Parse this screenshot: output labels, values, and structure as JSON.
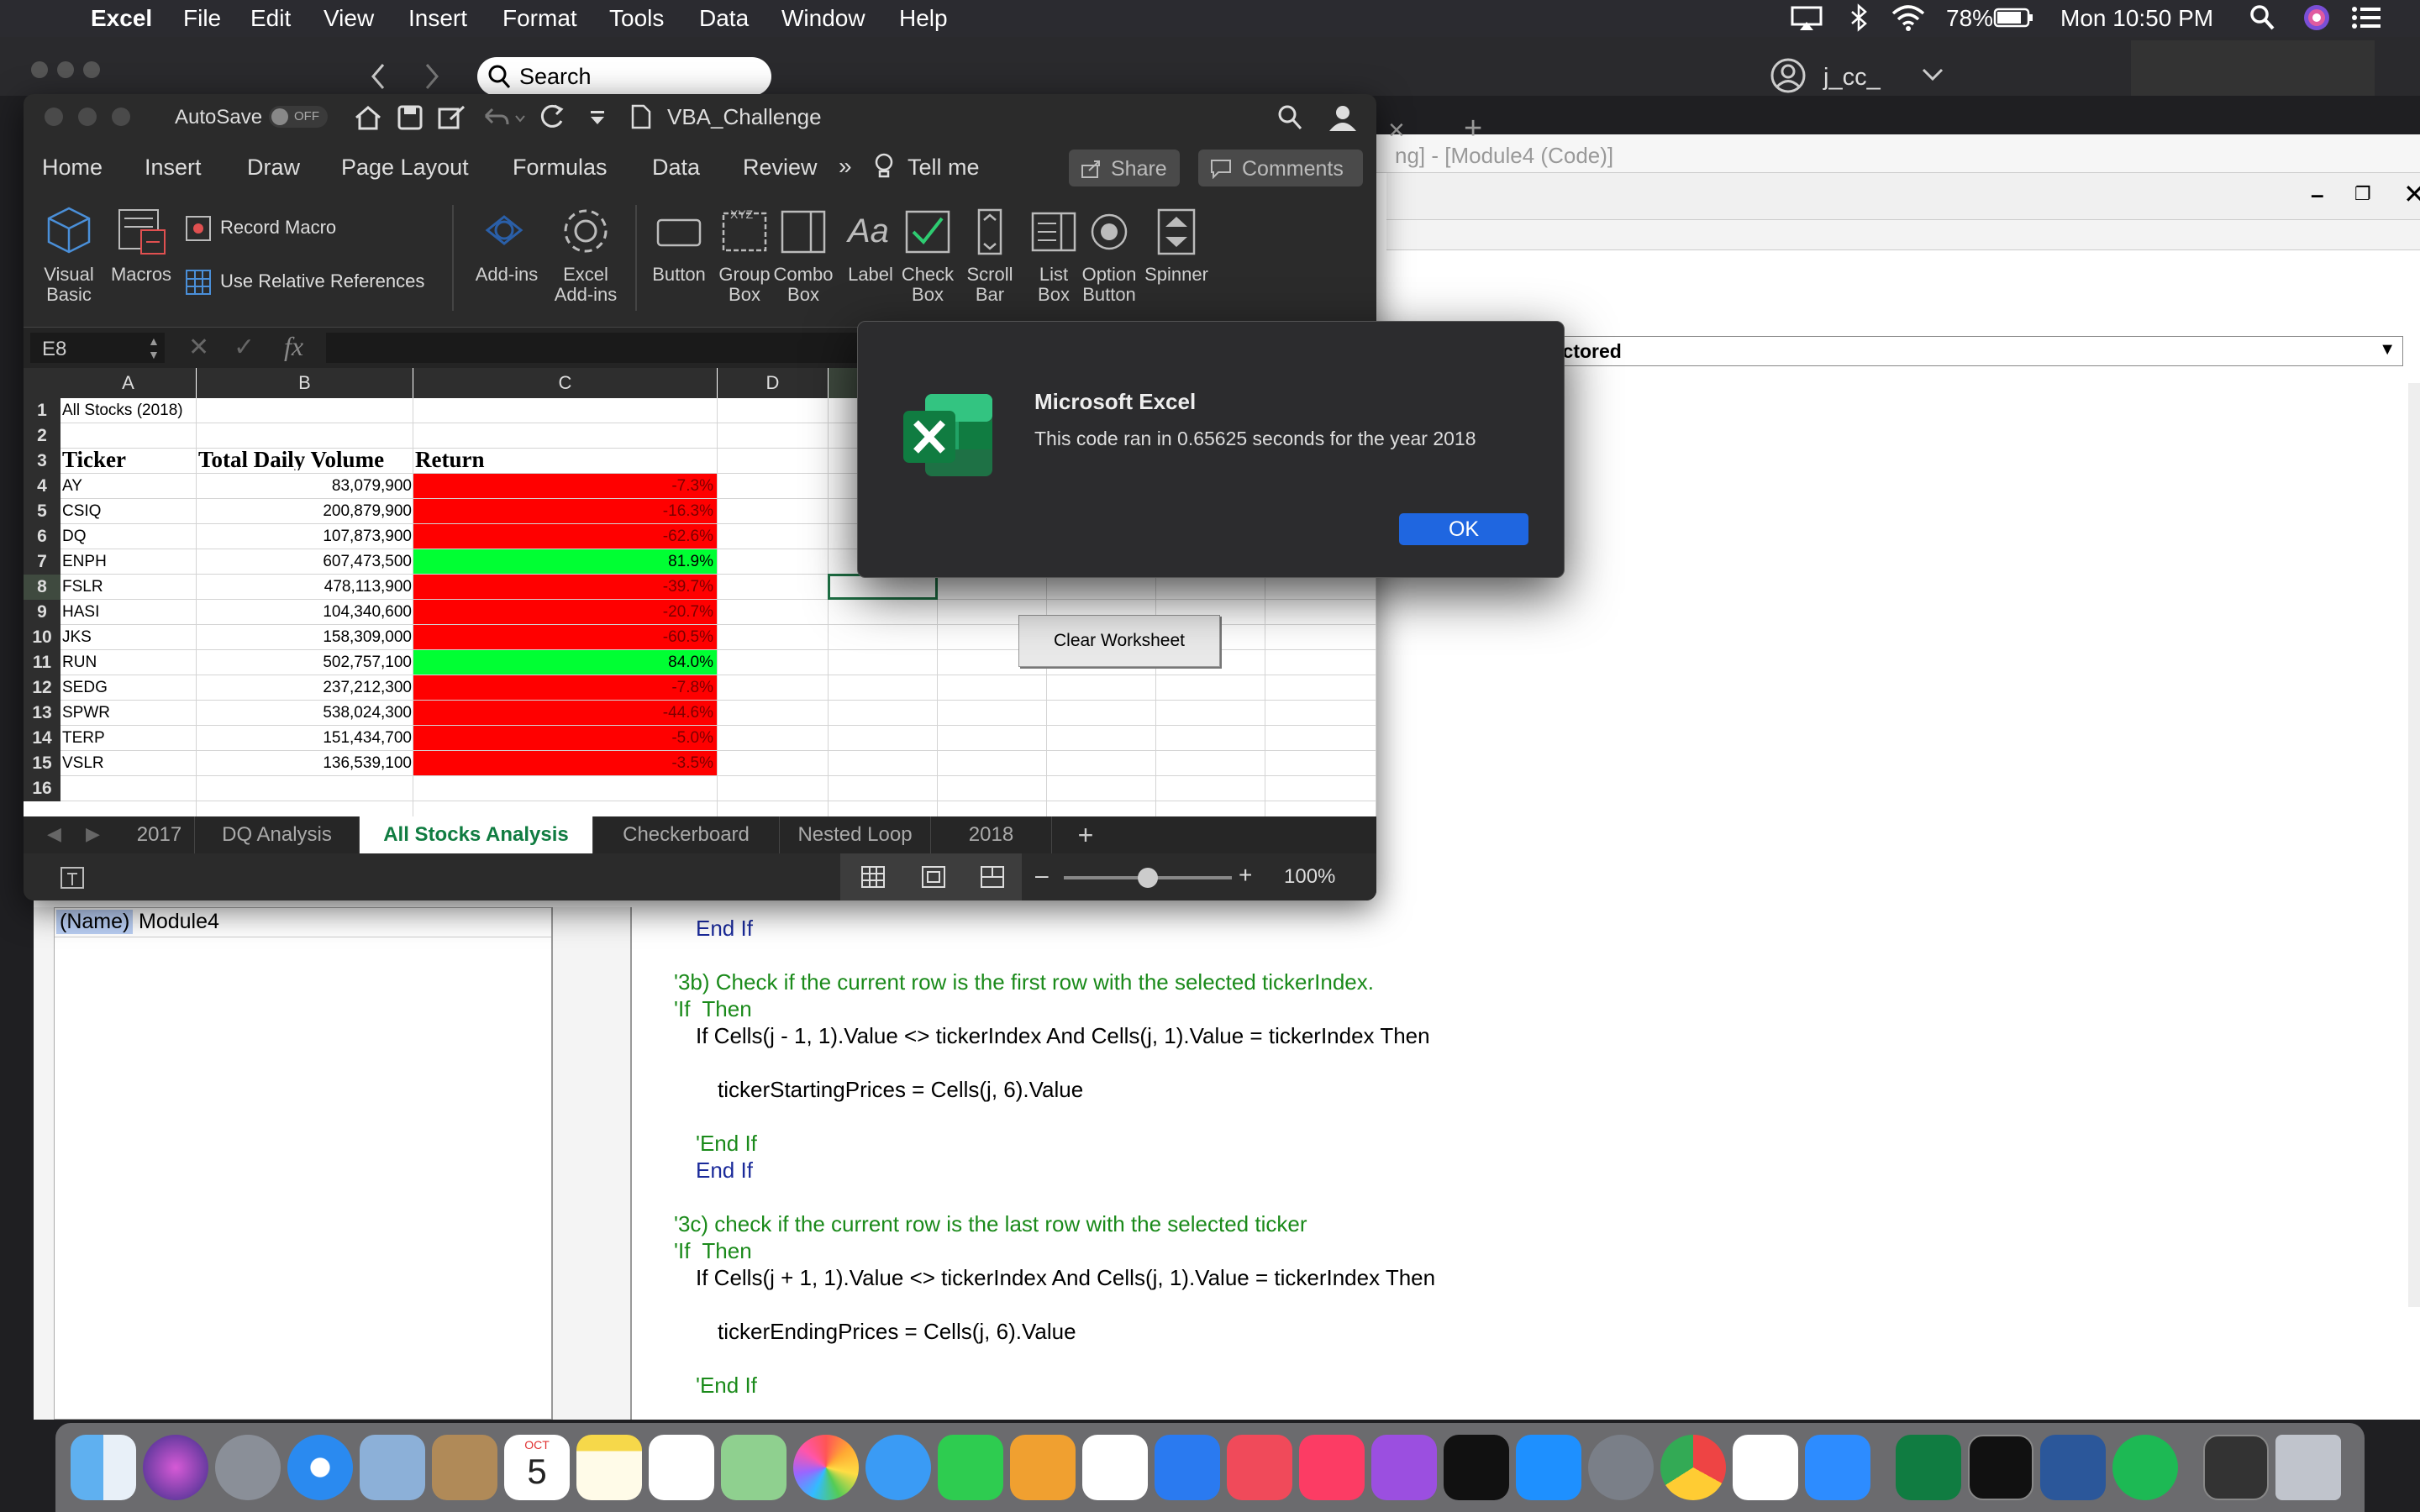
{
  "menubar": {
    "app": "Excel",
    "items": [
      "File",
      "Edit",
      "View",
      "Insert",
      "Format",
      "Tools",
      "Data",
      "Window",
      "Help"
    ],
    "battery": "78%",
    "clock": "Mon 10:50 PM"
  },
  "browser": {
    "search_label": "Search",
    "user": "j_cc_"
  },
  "vbe": {
    "title": "ng] - [Module4 (Code)]",
    "procedure": "tocksAnalysisRefactored",
    "props_name_label": "(Name)",
    "props_name_value": "Module4",
    "code": [
      {
        "t": "End If",
        "c": "kw",
        "indent": 1
      },
      {
        "t": "",
        "c": "",
        "indent": 0
      },
      {
        "t": "'3b) Check if the current row is the first row with the selected tickerIndex.",
        "c": "cm",
        "indent": 0
      },
      {
        "t": "'If  Then",
        "c": "cm",
        "indent": 0
      },
      {
        "t": "If Cells(j - 1, 1).Value <> tickerIndex And Cells(j, 1).Value = tickerIndex Then",
        "c": "mix",
        "indent": 1
      },
      {
        "t": "",
        "c": "",
        "indent": 0
      },
      {
        "t": "tickerStartingPrices = Cells(j, 6).Value",
        "c": "",
        "indent": 2
      },
      {
        "t": "",
        "c": "",
        "indent": 0
      },
      {
        "t": "'End If",
        "c": "cm",
        "indent": 1
      },
      {
        "t": "End If",
        "c": "kw",
        "indent": 1
      },
      {
        "t": "",
        "c": "",
        "indent": 0
      },
      {
        "t": "'3c) check if the current row is the last row with the selected ticker",
        "c": "cm",
        "indent": 0
      },
      {
        "t": "'If  Then",
        "c": "cm",
        "indent": 0
      },
      {
        "t": "If Cells(j + 1, 1).Value <> tickerIndex And Cells(j, 1).Value = tickerIndex Then",
        "c": "mix",
        "indent": 1
      },
      {
        "t": "",
        "c": "",
        "indent": 0
      },
      {
        "t": "tickerEndingPrices = Cells(j, 6).Value",
        "c": "",
        "indent": 2
      },
      {
        "t": "",
        "c": "",
        "indent": 0
      },
      {
        "t": "'End If",
        "c": "cm",
        "indent": 1
      }
    ]
  },
  "excel": {
    "autosave": "AutoSave",
    "autosave_state": "OFF",
    "doc_title": "VBA_Challenge",
    "tabs": [
      "Home",
      "Insert",
      "Draw",
      "Page Layout",
      "Formulas",
      "Data",
      "Review"
    ],
    "tell_me": "Tell me",
    "share": "Share",
    "comments": "Comments",
    "ribbon": {
      "visual_basic": [
        "Visual",
        "Basic"
      ],
      "macros": "Macros",
      "record_macro": "Record Macro",
      "relative_refs": "Use Relative References",
      "addins": "Add-ins",
      "excel_addins": [
        "Excel",
        "Add-ins"
      ],
      "controls": [
        [
          "Button",
          ""
        ],
        [
          "Group",
          "Box"
        ],
        [
          "Combo",
          "Box"
        ],
        [
          "Label",
          ""
        ],
        [
          "Check",
          "Box"
        ],
        [
          "Scroll",
          "Bar"
        ],
        [
          "List",
          "Box"
        ],
        [
          "Option",
          "Button"
        ],
        [
          "Spinner",
          ""
        ]
      ]
    },
    "name_box": "E8",
    "columns": [
      "A",
      "B",
      "C",
      "D"
    ],
    "sheet": {
      "title": "All Stocks (2018)",
      "headers": [
        "Ticker",
        "Total Daily Volume",
        "Return"
      ],
      "rows": [
        {
          "ticker": "AY",
          "volume": "83,079,900",
          "ret": "-7.3%",
          "pos": false
        },
        {
          "ticker": "CSIQ",
          "volume": "200,879,900",
          "ret": "-16.3%",
          "pos": false
        },
        {
          "ticker": "DQ",
          "volume": "107,873,900",
          "ret": "-62.6%",
          "pos": false
        },
        {
          "ticker": "ENPH",
          "volume": "607,473,500",
          "ret": "81.9%",
          "pos": true
        },
        {
          "ticker": "FSLR",
          "volume": "478,113,900",
          "ret": "-39.7%",
          "pos": false
        },
        {
          "ticker": "HASI",
          "volume": "104,340,600",
          "ret": "-20.7%",
          "pos": false
        },
        {
          "ticker": "JKS",
          "volume": "158,309,000",
          "ret": "-60.5%",
          "pos": false
        },
        {
          "ticker": "RUN",
          "volume": "502,757,100",
          "ret": "84.0%",
          "pos": true
        },
        {
          "ticker": "SEDG",
          "volume": "237,212,300",
          "ret": "-7.8%",
          "pos": false
        },
        {
          "ticker": "SPWR",
          "volume": "538,024,300",
          "ret": "-44.6%",
          "pos": false
        },
        {
          "ticker": "TERP",
          "volume": "151,434,700",
          "ret": "-5.0%",
          "pos": false
        },
        {
          "ticker": "VSLR",
          "volume": "136,539,100",
          "ret": "-3.5%",
          "pos": false
        }
      ],
      "row_numbers": [
        "1",
        "2",
        "3",
        "4",
        "5",
        "6",
        "7",
        "8",
        "9",
        "10",
        "11",
        "12",
        "13",
        "14",
        "15",
        "16"
      ]
    },
    "clear_button": "Clear Worksheet",
    "sheet_tabs": [
      "2017",
      "DQ Analysis",
      "All Stocks Analysis",
      "Checkerboard",
      "Nested Loop",
      "2018"
    ],
    "active_tab": "All Stocks Analysis",
    "zoom": "100%",
    "zoom_level": 0.5
  },
  "dialog": {
    "title": "Microsoft Excel",
    "message": "This code ran in 0.65625 seconds for the year 2018",
    "ok": "OK"
  },
  "dock": {
    "calendar_month": "OCT",
    "calendar_day": "5"
  },
  "colors": {
    "negative": "#ff0000",
    "positive": "#00ff33",
    "accent": "#1a73e8",
    "excel_green": "#107c41"
  }
}
